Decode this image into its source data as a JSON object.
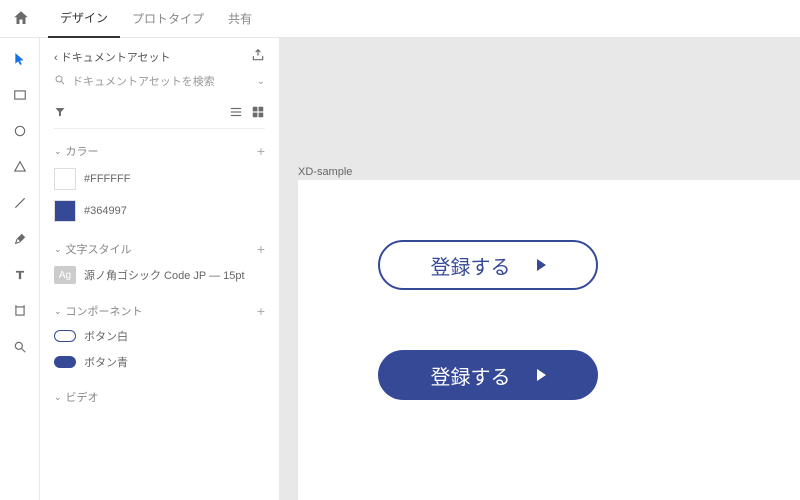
{
  "topbar": {
    "tabs": [
      "デザイン",
      "プロトタイプ",
      "共有"
    ],
    "activeIndex": 0
  },
  "panel": {
    "back_label": "ドキュメントアセット",
    "search_placeholder": "ドキュメントアセットを検索",
    "sections": {
      "colors": {
        "title": "カラー",
        "items": [
          {
            "hex": "#FFFFFF",
            "label": "#FFFFFF"
          },
          {
            "hex": "#364997",
            "label": "#364997"
          }
        ]
      },
      "textStyles": {
        "title": "文字スタイル",
        "items": [
          {
            "label": "源ノ角ゴシック Code JP — 15pt"
          }
        ]
      },
      "components": {
        "title": "コンポーネント",
        "items": [
          {
            "kind": "white",
            "label": "ボタン白"
          },
          {
            "kind": "blue",
            "label": "ボタン青"
          }
        ]
      },
      "video": {
        "title": "ビデオ"
      }
    }
  },
  "canvas": {
    "artboard_name": "XD-sample",
    "button_outline_label": "登録する",
    "button_filled_label": "登録する"
  },
  "colors": {
    "brand": "#364997"
  }
}
